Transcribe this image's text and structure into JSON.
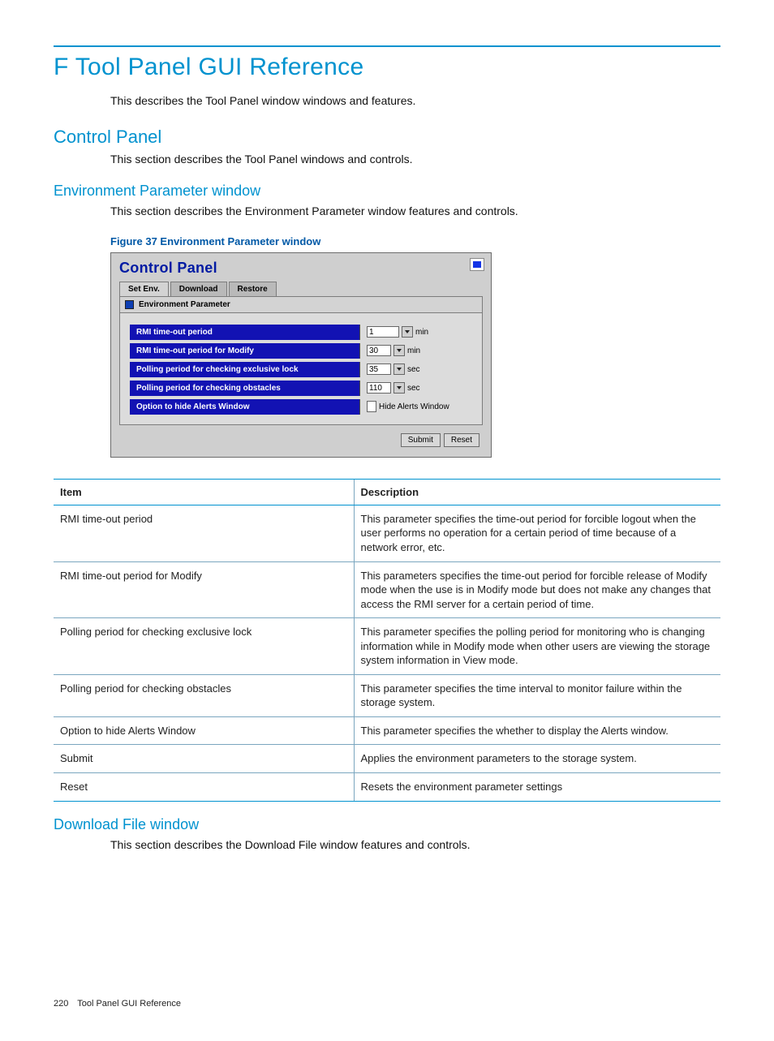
{
  "page": {
    "title": "F Tool Panel GUI Reference",
    "intro": "This describes the Tool Panel window windows and features."
  },
  "section1": {
    "title": "Control Panel",
    "body": "This section describes the Tool Panel windows and controls."
  },
  "section2": {
    "title": "Environment Parameter window",
    "body": "This section describes the Environment Parameter window features and controls."
  },
  "figure": {
    "caption": "Figure 37 Environment Parameter window"
  },
  "cp": {
    "title": "Control Panel",
    "tabs": {
      "set_env": "Set Env.",
      "download": "Download",
      "restore": "Restore"
    },
    "subhead": "Environment Parameter",
    "rows": {
      "r1": {
        "label": "RMI time-out period",
        "value": "1",
        "unit": "min"
      },
      "r2": {
        "label": "RMI time-out period for Modify",
        "value": "30",
        "unit": "min"
      },
      "r3": {
        "label": "Polling period for checking exclusive lock",
        "value": "35",
        "unit": "sec"
      },
      "r4": {
        "label": "Polling period for checking obstacles",
        "value": "110",
        "unit": "sec"
      },
      "r5": {
        "label": "Option to hide Alerts Window",
        "check_label": "Hide Alerts Window"
      }
    },
    "buttons": {
      "submit": "Submit",
      "reset": "Reset"
    }
  },
  "table": {
    "headers": {
      "item": "Item",
      "desc": "Description"
    },
    "rows": {
      "r1": {
        "item": "RMI time-out period",
        "desc": "This parameter specifies the time-out period for forcible logout when the user performs no operation for a certain period of time because of a network error, etc."
      },
      "r2": {
        "item": "RMI time-out period for Modify",
        "desc": "This parameters specifies the time-out period for forcible release of Modify mode when the use is in Modify mode but does not make any changes that access the RMI server for a certain period of time."
      },
      "r3": {
        "item": "Polling period for checking exclusive lock",
        "desc": "This parameter specifies the polling period for monitoring who is changing information while in Modify mode when other users are viewing the storage system information in View mode."
      },
      "r4": {
        "item": "Polling period for checking obstacles",
        "desc": "This parameter specifies the time interval to monitor failure within the storage system."
      },
      "r5": {
        "item": "Option to hide Alerts Window",
        "desc": "This parameter specifies the whether to display the Alerts window."
      },
      "r6": {
        "item": "Submit",
        "desc": "Applies the environment parameters to the storage system."
      },
      "r7": {
        "item": "Reset",
        "desc": "Resets the environment parameter settings"
      }
    }
  },
  "section3": {
    "title": "Download File window",
    "body": "This section describes the Download File window features and controls."
  },
  "footer": {
    "page_no": "220",
    "label": "Tool Panel GUI Reference"
  }
}
